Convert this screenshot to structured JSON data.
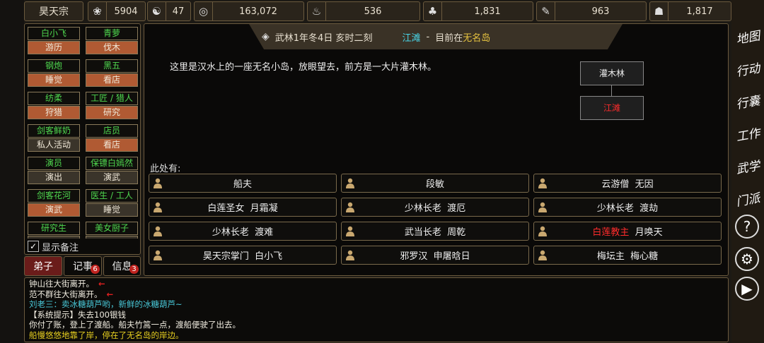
{
  "sect_name": "昊天宗",
  "resources": [
    {
      "icon": "swirl-icon",
      "glyph": "❀",
      "value": "5904"
    },
    {
      "icon": "yin-yang-icon",
      "glyph": "☯",
      "value": "47"
    },
    {
      "icon": "coin-icon",
      "glyph": "◎",
      "value": "163,072"
    },
    {
      "icon": "food-icon",
      "glyph": "♨",
      "value": "536"
    },
    {
      "icon": "herb-icon",
      "glyph": "♣",
      "value": "1,831"
    },
    {
      "icon": "wood-icon",
      "glyph": "✎",
      "value": "963"
    },
    {
      "icon": "ore-icon",
      "glyph": "☗",
      "value": "1,817"
    }
  ],
  "disciples": [
    {
      "name": "白小飞",
      "status": "游历",
      "style": "a"
    },
    {
      "name": "青萝",
      "status": "伐木",
      "style": "a"
    },
    {
      "name": "钢炮",
      "status": "睡觉",
      "style": "a"
    },
    {
      "name": "黑五",
      "status": "看店",
      "style": "a"
    },
    {
      "name": "纺柔",
      "status": "狩猎",
      "style": "a"
    },
    {
      "name": "工匠 / 猎人",
      "status": "研究",
      "style": "a"
    },
    {
      "name": "剑客鲜奶",
      "status": "私人活动",
      "style": "b"
    },
    {
      "name": "店员",
      "status": "看店",
      "style": "a"
    },
    {
      "name": "演员",
      "status": "演出",
      "style": "b"
    },
    {
      "name": "保镖白嫣然",
      "status": "演武",
      "style": "b"
    },
    {
      "name": "剑客花河",
      "status": "演武",
      "style": "a"
    },
    {
      "name": "医生 / 工人",
      "status": "睡觉",
      "style": "b"
    },
    {
      "name": "研究生",
      "status": "",
      "style": "b"
    },
    {
      "name": "美女厨子",
      "status": "",
      "style": "b"
    }
  ],
  "show_memo_label": "显示备注",
  "tabs": [
    {
      "label": "弟子",
      "badge": ""
    },
    {
      "label": "记事",
      "badge": "6"
    },
    {
      "label": "信息",
      "badge": "3"
    }
  ],
  "header": {
    "date": "武林1年冬4日 亥时二刻",
    "location": "江滩",
    "dash": "-",
    "current_prefix": "目前在",
    "island": "无名岛"
  },
  "description": "这里是汉水上的一座无名小岛，放眼望去，前方是一大片灌木林。",
  "map": {
    "north": "灌木林",
    "current": "江滩"
  },
  "here_label": "此处有:",
  "npcs": [
    {
      "title": "船夫",
      "name": "",
      "title_red": false
    },
    {
      "title": "段敏",
      "name": "",
      "title_red": false
    },
    {
      "title": "云游僧",
      "name": "无因",
      "title_red": false
    },
    {
      "title": "白莲圣女",
      "name": "月霜凝",
      "title_red": false
    },
    {
      "title": "少林长老",
      "name": "渡厄",
      "title_red": false
    },
    {
      "title": "少林长老",
      "name": "渡劫",
      "title_red": false
    },
    {
      "title": "少林长老",
      "name": "渡难",
      "title_red": false
    },
    {
      "title": "武当长老",
      "name": "周乾",
      "title_red": false
    },
    {
      "title": "白莲教主",
      "name": "月唤天",
      "title_red": true
    },
    {
      "title": "昊天宗掌门",
      "name": "白小飞",
      "title_red": false
    },
    {
      "title": "邪罗汉",
      "name": "申屠晗日",
      "title_red": false
    },
    {
      "title": "梅坛主",
      "name": "梅心糖",
      "title_red": false
    }
  ],
  "log": [
    {
      "text": "钟山往大街离开。",
      "color": "w",
      "arrow": "←"
    },
    {
      "text": "范不群往大街离开。",
      "color": "w",
      "arrow": "←"
    },
    {
      "text": "刘老三：卖冰糖葫芦哟，新鲜的冰糖葫芦~",
      "color": "c",
      "arrow": ""
    },
    {
      "text": "【系统提示】失去100银钱",
      "color": "w",
      "arrow": ""
    },
    {
      "text": "你付了账，登上了渡船。船夫竹篙一点，渡船便驶了出去。",
      "color": "w",
      "arrow": ""
    },
    {
      "text": "船慢悠悠地靠了岸，停在了无名岛的岸边。",
      "color": "y",
      "arrow": ""
    }
  ],
  "side_menu": [
    {
      "label": "地图",
      "icon": "map-button"
    },
    {
      "label": "行动",
      "icon": "action-button"
    },
    {
      "label": "行囊",
      "icon": "bag-button"
    },
    {
      "label": "工作",
      "icon": "work-button"
    },
    {
      "label": "武学",
      "icon": "martial-button"
    },
    {
      "label": "门派",
      "icon": "sect-button"
    }
  ],
  "help_glyph": "?",
  "settings_glyph": "⚙",
  "play_glyph": "▶"
}
